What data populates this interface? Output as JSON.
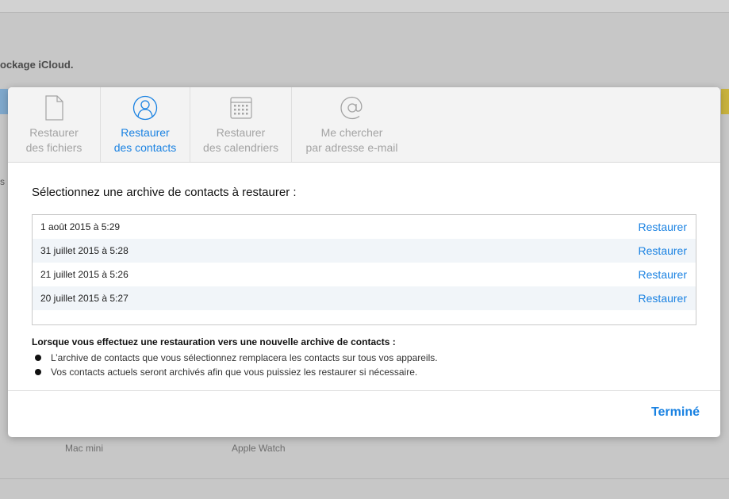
{
  "background": {
    "storage_text": "ockage iCloud.",
    "side_letter": "s",
    "devices": [
      "Mac mini",
      "Apple Watch"
    ]
  },
  "tabs": [
    {
      "line1": "Restaurer",
      "line2": "des fichiers",
      "icon": "document-icon",
      "active": false
    },
    {
      "line1": "Restaurer",
      "line2": "des contacts",
      "icon": "contacts-icon",
      "active": true
    },
    {
      "line1": "Restaurer",
      "line2": "des calendriers",
      "icon": "calendar-icon",
      "active": false
    },
    {
      "line1": "Me chercher",
      "line2": "par adresse e-mail",
      "icon": "at-icon",
      "active": false
    }
  ],
  "heading": "Sélectionnez une archive de contacts à restaurer :",
  "archives": [
    {
      "date": "1 août 2015 à 5:29",
      "action": "Restaurer"
    },
    {
      "date": "31 juillet 2015 à 5:28",
      "action": "Restaurer"
    },
    {
      "date": "21 juillet 2015 à 5:26",
      "action": "Restaurer"
    },
    {
      "date": "20 juillet 2015 à 5:27",
      "action": "Restaurer"
    }
  ],
  "note": {
    "title": "Lorsque vous effectuez une restauration vers une nouvelle archive de contacts :",
    "bullets": [
      "L’archive de contacts que vous sélectionnez remplacera les contacts sur tous vos appareils.",
      "Vos contacts actuels seront archivés afin que vous puissiez les restaurer si nécessaire."
    ]
  },
  "footer": {
    "done_label": "Terminé"
  },
  "colors": {
    "accent": "#1a82e2",
    "inactive": "#a3a3a3"
  }
}
